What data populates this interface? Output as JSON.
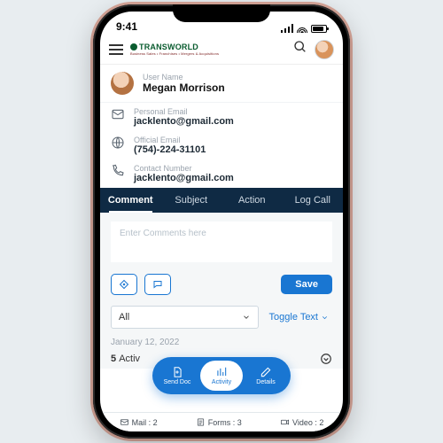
{
  "status": {
    "time": "9:41"
  },
  "header": {
    "brand_name": "TRANSWORLD",
    "brand_tag": "Business Sales • Franchises • Mergers & Acquisitions"
  },
  "user": {
    "label": "User Name",
    "name": "Megan Morrison"
  },
  "info": [
    {
      "icon": "mail",
      "label": "Personal Email",
      "value": "jacklento@gmail.com"
    },
    {
      "icon": "globe",
      "label": "Official Email",
      "value": "(754)-224-31101"
    },
    {
      "icon": "phone",
      "label": "Contact Number",
      "value": "jacklento@gmail.com"
    }
  ],
  "tabs": [
    "Comment",
    "Subject",
    "Action",
    "Log Call"
  ],
  "active_tab": 0,
  "comment": {
    "placeholder": "Enter Comments here",
    "save_label": "Save"
  },
  "filter": {
    "selected": "All",
    "toggle_label": "Toggle Text"
  },
  "timeline": {
    "date": "January 12, 2022",
    "count_prefix": "5",
    "count_label": "Activ"
  },
  "pill": [
    {
      "label": "Send Doc",
      "icon": "doc"
    },
    {
      "label": "Activity",
      "icon": "chart",
      "active": true
    },
    {
      "label": "Details",
      "icon": "edit"
    }
  ],
  "bottom": [
    {
      "icon": "mail",
      "label": "Mail : 2"
    },
    {
      "icon": "form",
      "label": "Forms : 3"
    },
    {
      "icon": "video",
      "label": "Video : 2"
    }
  ]
}
